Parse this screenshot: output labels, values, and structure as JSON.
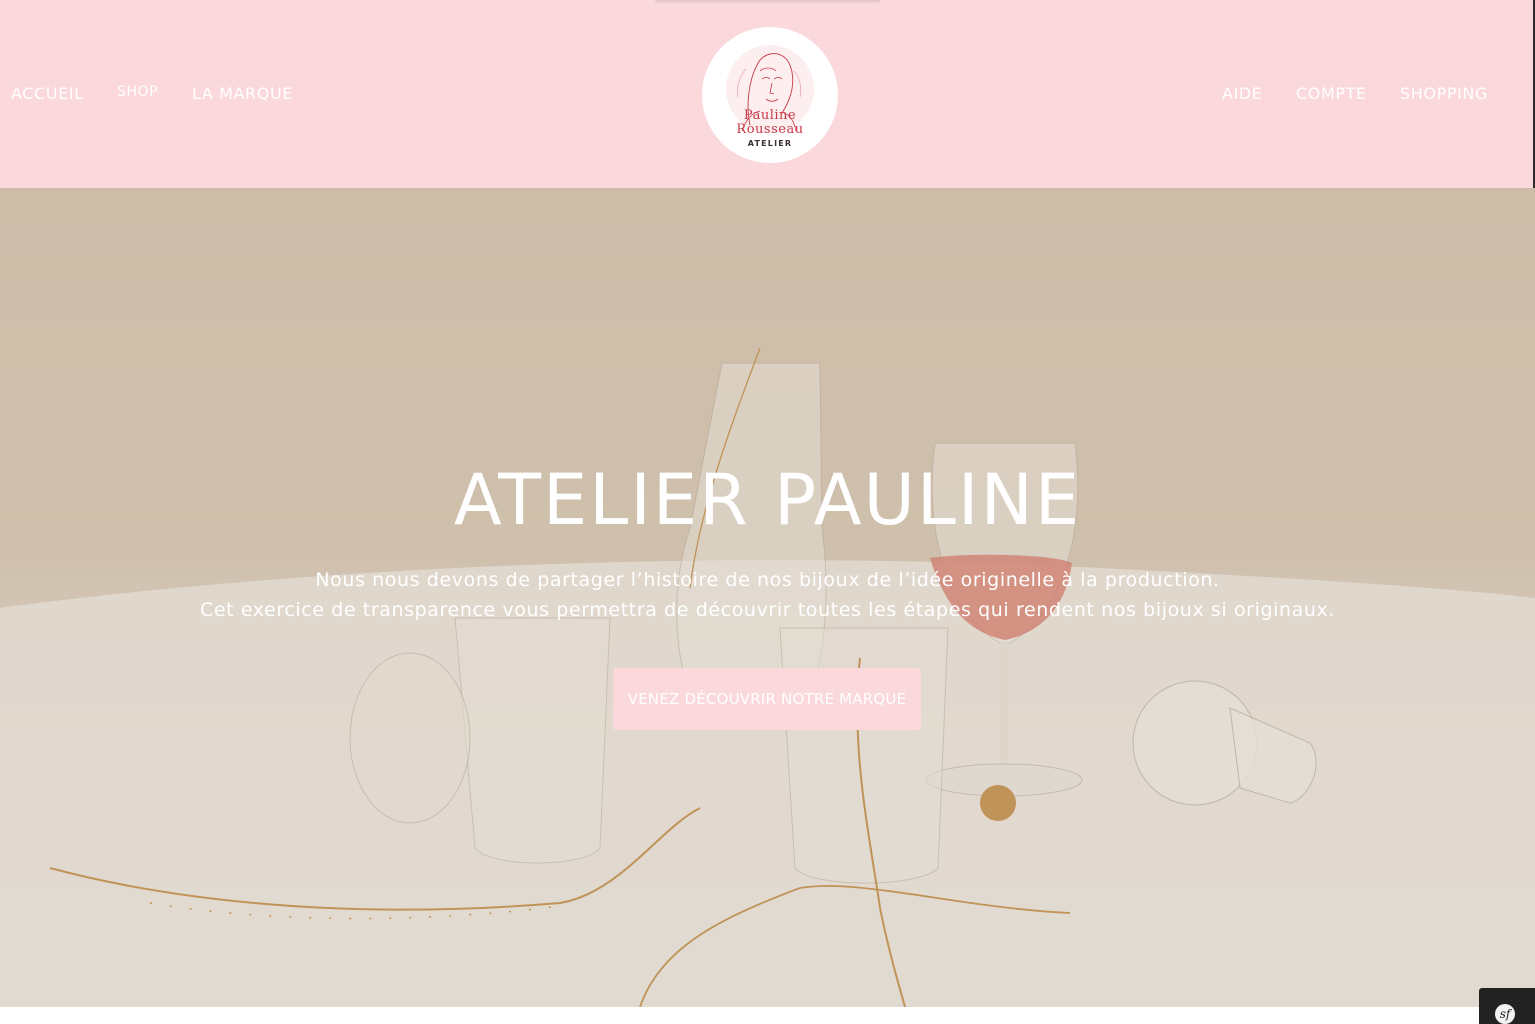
{
  "header": {
    "nav_left": [
      "ACCUEIL",
      "SHOP",
      "LA MARQUE"
    ],
    "nav_right": [
      "AIDE",
      "COMPTE",
      "SHOPPING"
    ],
    "logo": {
      "name_line1": "Pauline",
      "name_line2": "Rousseau",
      "subtitle": "ATELIER"
    }
  },
  "hero": {
    "title": "ATELIER PAULINE",
    "line1": "Nous nous devons de partager l’histoire de nos bijoux de l’idée originelle à la production.",
    "line2": "Cet exercice de transparence vous permettra de découvrir toutes les étapes qui rendent nos bijoux si originaux.",
    "cta_label": "VENEZ DÉCOUVRIR NOTRE MARQUE"
  },
  "dev_toolbar": {
    "label": "sf"
  },
  "colors": {
    "header_bg": "#fad8dc",
    "logo_text": "#c83a45",
    "cta_bg": "#fad8dc"
  }
}
